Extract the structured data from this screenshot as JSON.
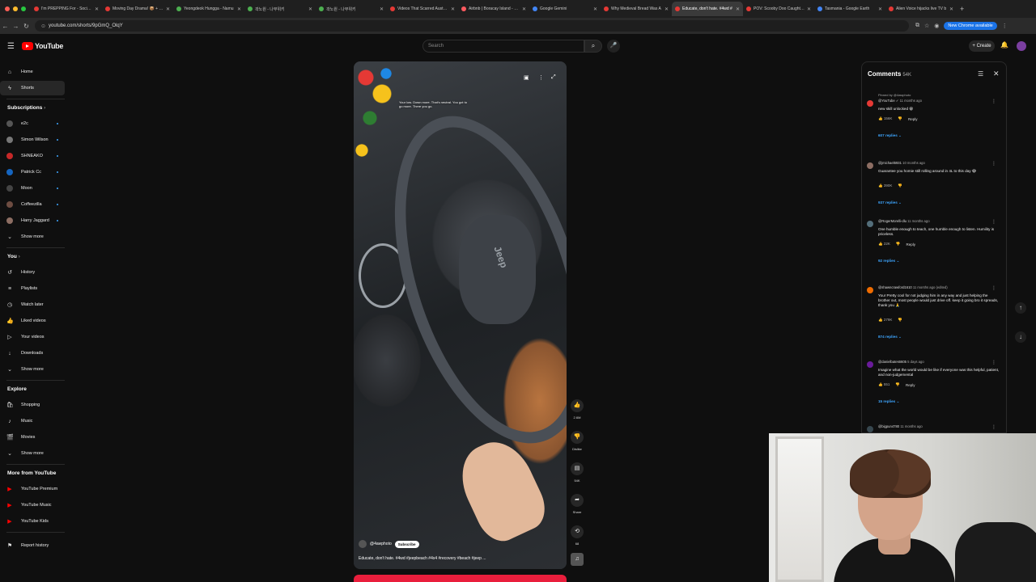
{
  "browser": {
    "tabs": [
      {
        "title": "I'm PREPPING For - Societal",
        "color": "#e53935"
      },
      {
        "title": "Moving Day Drama! 📦 + Ex",
        "color": "#e53935"
      },
      {
        "title": "Yeongdeok Hungga - Namu",
        "color": "#4caf50"
      },
      {
        "title": "곽노원 - 나무위키",
        "color": "#4caf50"
      },
      {
        "title": "곽노원 - 나무위키",
        "color": "#4caf50"
      },
      {
        "title": "Videos That Scarred Australi",
        "color": "#e53935"
      },
      {
        "title": "Airbnb | Boracay Island - Vac",
        "color": "#ff5a5f"
      },
      {
        "title": "Google Gemini",
        "color": "#4285f4"
      },
      {
        "title": "Why Medieval Bread Was A",
        "color": "#e53935"
      },
      {
        "title": "Educate, don't hate. #4wd #",
        "color": "#e53935",
        "active": true
      },
      {
        "title": "POV: Scooby Doo Caught Yo",
        "color": "#e53935"
      },
      {
        "title": "Tasmania - Google Earth",
        "color": "#4285f4"
      },
      {
        "title": "Alien Voice hijacks live TV b",
        "color": "#e53935"
      }
    ],
    "url": "youtube.com/shorts/9pGmQ_OlqY",
    "chrome_badge": "New Chrome available"
  },
  "header": {
    "logo_text": "YouTube",
    "search_placeholder": "Search",
    "create_label": "+ Create"
  },
  "sidebar": {
    "primary": [
      {
        "label": "Home",
        "icon": "home-icon",
        "glyph": "⌂"
      },
      {
        "label": "Shorts",
        "icon": "shorts-icon",
        "glyph": "ϟ",
        "active": true
      }
    ],
    "subscriptions_title": "Subscriptions",
    "subscriptions": [
      {
        "label": "e2c",
        "color": "#555"
      },
      {
        "label": "Simon Wilson",
        "color": "#777"
      },
      {
        "label": "SHNEAKO",
        "color": "#c62828"
      },
      {
        "label": "Patrick Cc",
        "color": "#1565c0"
      },
      {
        "label": "Moon",
        "color": "#444"
      },
      {
        "label": "Coffeezilla",
        "color": "#6d4c41"
      },
      {
        "label": "Harry Jaggard",
        "color": "#8d6e63"
      }
    ],
    "show_more": "Show more",
    "you_title": "You",
    "you_items": [
      {
        "label": "History",
        "glyph": "↺"
      },
      {
        "label": "Playlists",
        "glyph": "≡"
      },
      {
        "label": "Watch later",
        "glyph": "◷"
      },
      {
        "label": "Liked videos",
        "glyph": "👍"
      },
      {
        "label": "Your videos",
        "glyph": "▷"
      },
      {
        "label": "Downloads",
        "glyph": "↓"
      }
    ],
    "you_show_more": "Show more",
    "explore_title": "Explore",
    "explore_items": [
      {
        "label": "Shopping",
        "glyph": "🛍"
      },
      {
        "label": "Music",
        "glyph": "♪"
      },
      {
        "label": "Movies",
        "glyph": "🎬"
      }
    ],
    "explore_show_more": "Show more",
    "more_title": "More from YouTube",
    "more_items": [
      {
        "label": "YouTube Premium"
      },
      {
        "label": "YouTube Music"
      },
      {
        "label": "YouTube Kids"
      }
    ],
    "report": "Report history"
  },
  "video": {
    "overlay_caption": "Your low. Down more. That's neutral. You got to go more. There you go.",
    "channel": "@4awphoto",
    "subscribe": "Subscribe",
    "title": "Educate, don't hate. #4wd #jeepbeach #4x4 #recovery #beach #jeep ..."
  },
  "actions": {
    "like": "2.6M",
    "dislike": "Dislike",
    "comments": "54K",
    "share": "Share",
    "remix": "68"
  },
  "comments": {
    "title": "Comments",
    "count": "54K",
    "items": [
      {
        "pinned": "Pinned by @4awphoto",
        "author": "@YouTube ✓",
        "time": "11 months ago",
        "text": "new skill unlocked 😁",
        "likes": "156K",
        "reply": "Reply",
        "replies": "607 replies",
        "color": "#e53935"
      },
      {
        "author": "@jmichael6931",
        "time": "10 months ago",
        "text": "Guarantee you homie still rolling around in 4L to this day 😂",
        "likes": "390K",
        "replies": "937 replies",
        "color": "#8d6e63"
      },
      {
        "author": "@RogerMorelli-dlu",
        "time": "11 months ago",
        "text": "One humble enough to teach, one humble enough to listen. Humility is priceless.",
        "likes": "22K",
        "reply": "Reply",
        "replies": "92 replies",
        "color": "#546e7a"
      },
      {
        "author": "@shawncrawford1610",
        "time": "11 months ago (edited)",
        "text": "Your Pretty cool for not judging him in any way and just helping the brother out, most people would just drive off. keep it going bro it spreads, thank you 🙏",
        "likes": "279K",
        "replies": "874 replies",
        "color": "#ef6c00"
      },
      {
        "author": "@danielbates6605",
        "time": "5 days ago",
        "text": "Imagine what the world would be like if everyone was this helpful, patient, and non-judgemental",
        "likes": "551",
        "reply": "Reply",
        "replies": "15 replies",
        "color": "#6a1b9a"
      },
      {
        "author": "@bigpun4780",
        "time": "11 months ago",
        "text": "",
        "color": "#37474f"
      }
    ]
  }
}
